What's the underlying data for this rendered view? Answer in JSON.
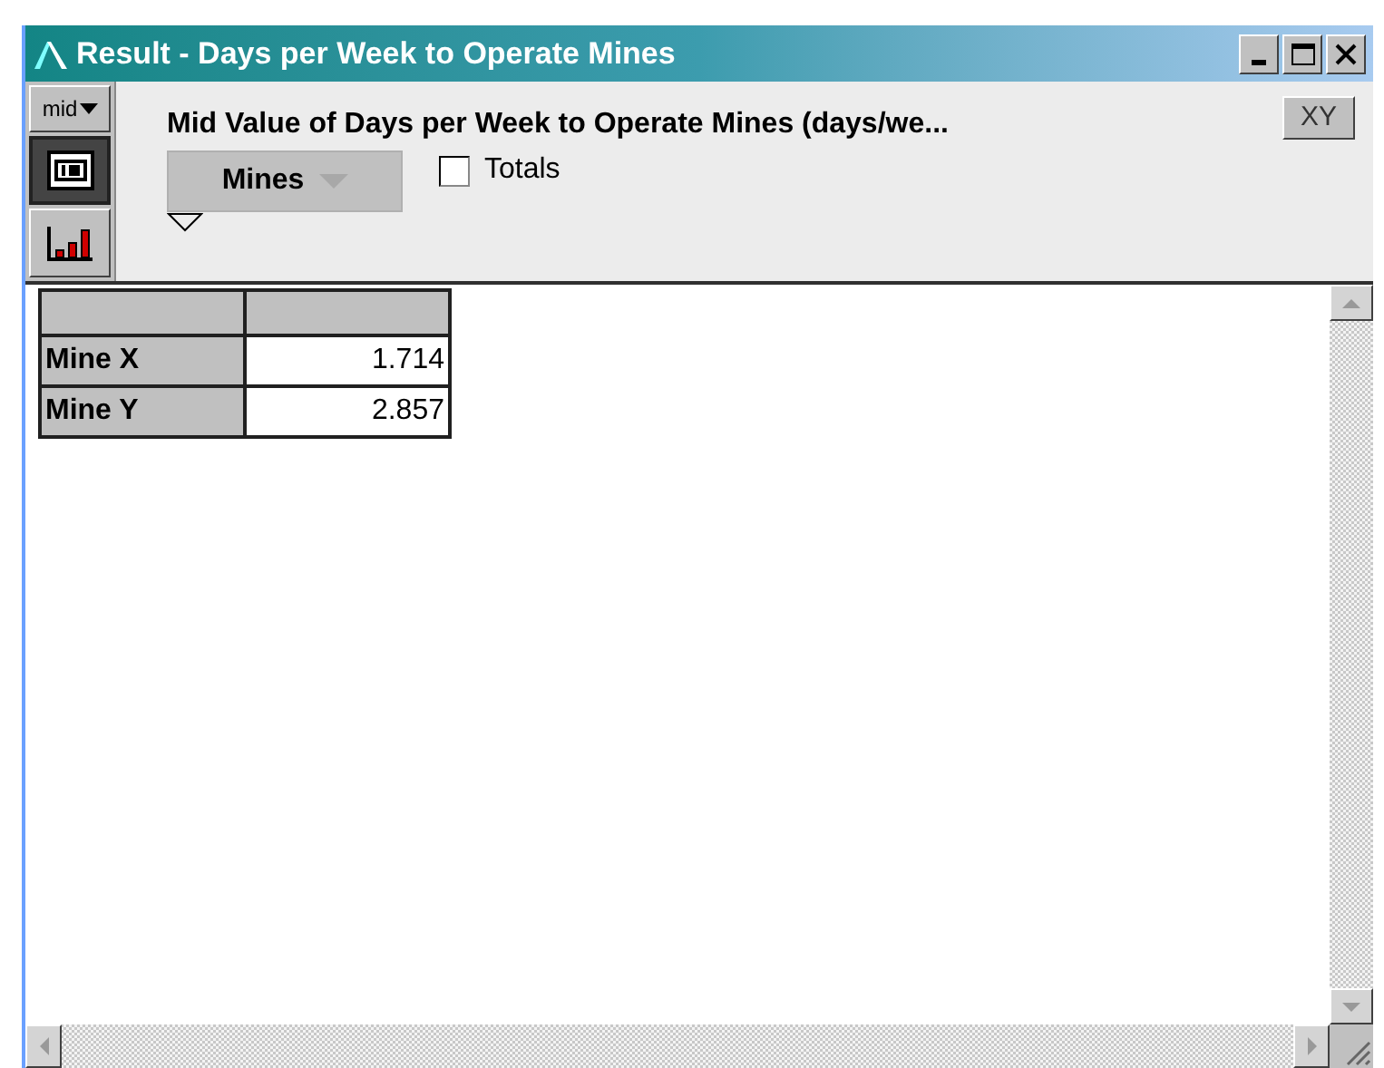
{
  "window": {
    "title": "Result - Days per Week to Operate Mines"
  },
  "toolbar": {
    "mode": "mid",
    "views": [
      {
        "kind": "table",
        "selected": true
      },
      {
        "kind": "graph",
        "selected": false
      }
    ],
    "heading": "Mid Value of Days per Week to Operate Mines (days/we...",
    "index_button": "Mines",
    "totals": {
      "label": "Totals",
      "checked": false
    },
    "xy_button": "XY"
  },
  "table": {
    "rows": [
      {
        "label": "Mine X",
        "value": "1.714"
      },
      {
        "label": "Mine Y",
        "value": "2.857"
      }
    ]
  }
}
